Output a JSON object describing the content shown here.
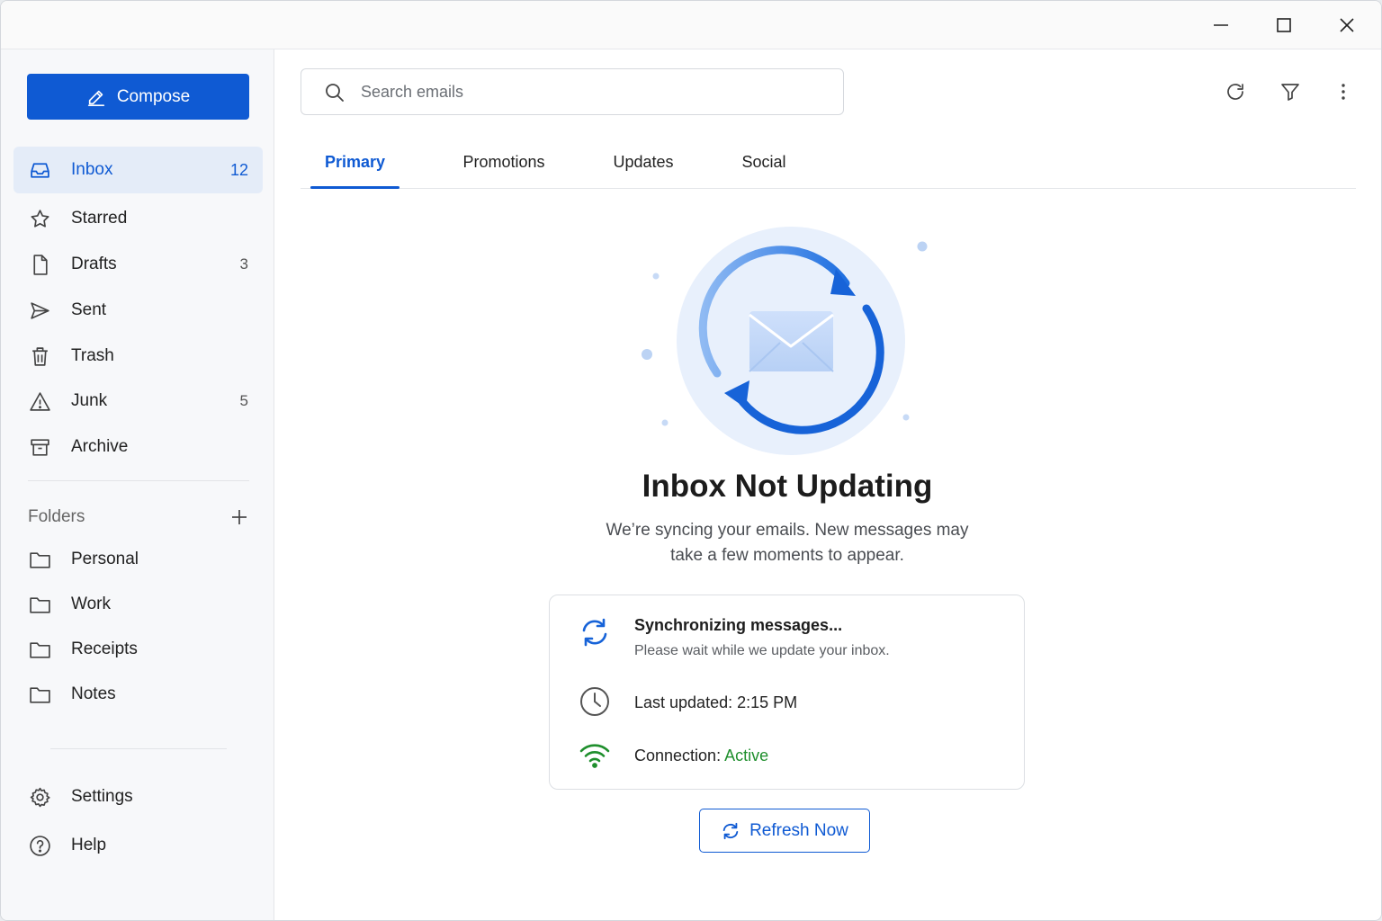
{
  "window_controls": [
    "minimize-icon",
    "maximize-icon",
    "close-icon"
  ],
  "sidebar": {
    "compose_label": "Compose",
    "items": [
      {
        "label": "Inbox",
        "count": "12",
        "icon": "inbox-icon",
        "active": true
      },
      {
        "label": "Starred",
        "count": "",
        "icon": "star-icon"
      },
      {
        "label": "Drafts",
        "count": "3",
        "icon": "draft-icon"
      },
      {
        "label": "Sent",
        "count": "",
        "icon": "send-icon"
      },
      {
        "label": "Trash",
        "count": "",
        "icon": "trash-icon"
      },
      {
        "label": "Junk",
        "count": "5",
        "icon": "warning-icon"
      },
      {
        "label": "Archive",
        "count": "",
        "icon": "archive-icon"
      }
    ],
    "folders_heading": "Folders",
    "folders": [
      {
        "label": "Personal"
      },
      {
        "label": "Work"
      },
      {
        "label": "Receipts"
      },
      {
        "label": "Notes"
      }
    ],
    "bottom": [
      {
        "label": "Settings",
        "icon": "gear-icon"
      },
      {
        "label": "Help",
        "icon": "help-icon"
      }
    ]
  },
  "search": {
    "placeholder": "Search emails"
  },
  "toolbar": [
    "refresh-icon",
    "filter-icon",
    "more-icon"
  ],
  "tabs": [
    {
      "label": "Primary",
      "active": true
    },
    {
      "label": "Promotions"
    },
    {
      "label": "Updates"
    },
    {
      "label": "Social"
    }
  ],
  "empty_state": {
    "title": "Inbox Not Updating",
    "subtitle_line1": "We’re syncing your emails. New messages may",
    "subtitle_line2": "take a few moments to appear."
  },
  "status": {
    "sync_title": "Synchronizing messages...",
    "sync_sub": "Please wait while we update your inbox.",
    "last_updated": "Last updated: 2:15 PM",
    "connection_label": "Connection: ",
    "connection_value": "Active"
  },
  "refresh_button": "Refresh Now",
  "colors": {
    "accent": "#0f5ad3",
    "active_bg": "#e4ecf8",
    "success": "#1f8f2d"
  }
}
